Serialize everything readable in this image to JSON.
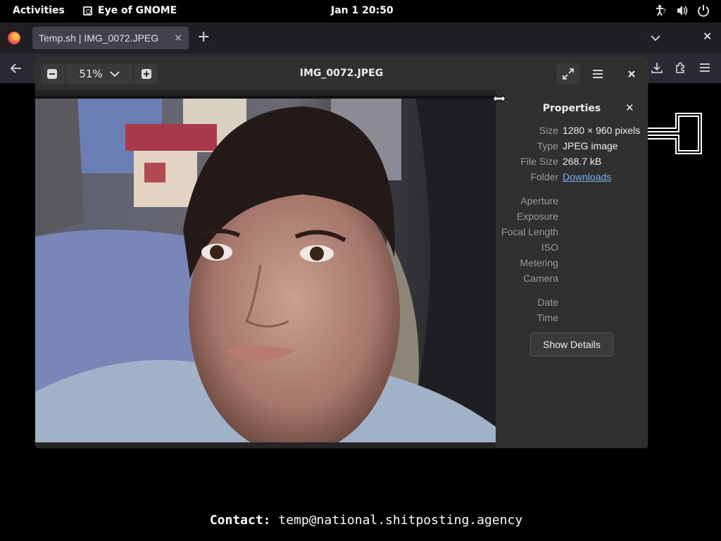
{
  "topbar": {
    "activities": "Activities",
    "app_name": "Eye of GNOME",
    "clock": "Jan 1  20:50"
  },
  "browser": {
    "tab_title": "Temp.sh | IMG_0072.JPEG",
    "tab_close": "×",
    "new_tab": "+",
    "close_window": "✕"
  },
  "viewer": {
    "title": "IMG_0072.JPEG",
    "zoom": "51%"
  },
  "properties": {
    "title": "Properties",
    "close": "✕",
    "size_label": "Size",
    "size_value": "1280 × 960 pixels",
    "type_label": "Type",
    "type_value": "JPEG image",
    "filesize_label": "File Size",
    "filesize_value": "268.7 kB",
    "folder_label": "Folder",
    "folder_value": "Downloads",
    "aperture_label": "Aperture",
    "exposure_label": "Exposure",
    "focal_label": "Focal Length",
    "iso_label": "ISO",
    "metering_label": "Metering",
    "camera_label": "Camera",
    "date_label": "Date",
    "time_label": "Time",
    "show_details": "Show Details"
  },
  "page": {
    "contact_label": "Contact:",
    "contact_value": "temp@national.shitposting.agency"
  },
  "icons": {
    "accessibility": "accessibility-icon",
    "volume": "volume-icon",
    "power": "power-icon",
    "firefox": "firefox-logo-icon"
  }
}
